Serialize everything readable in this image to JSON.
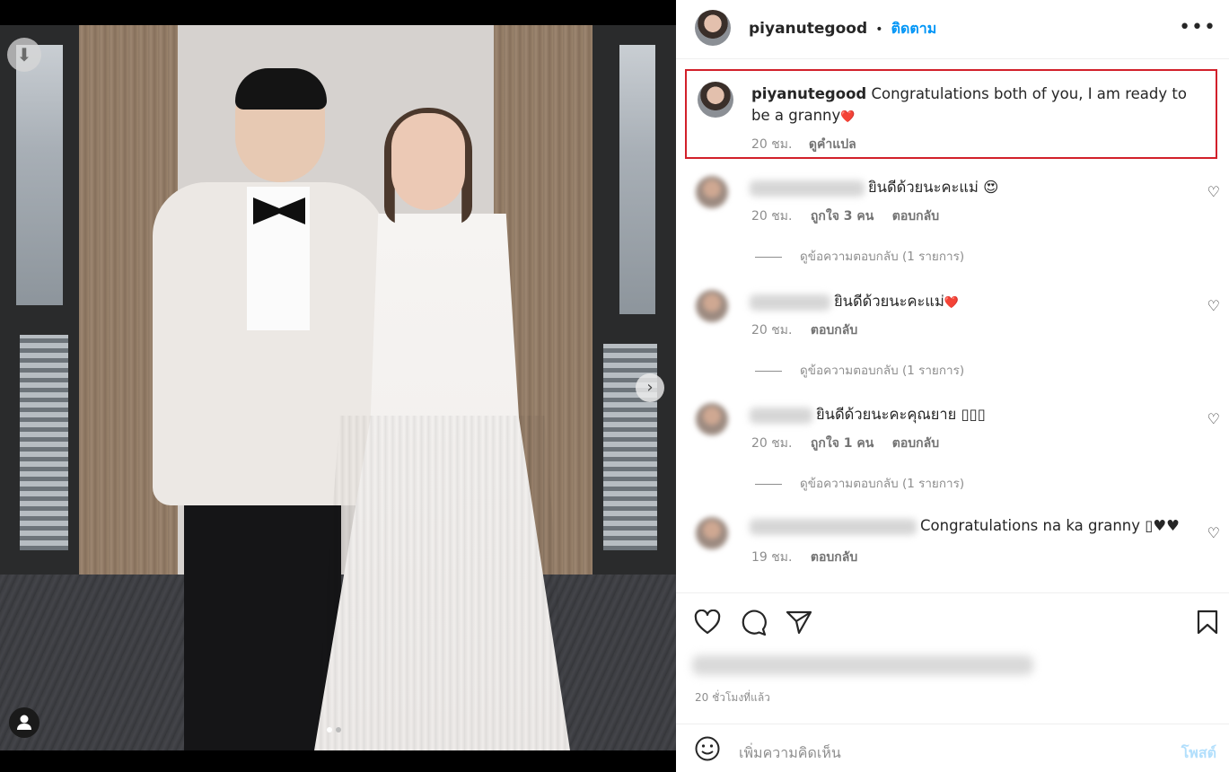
{
  "post": {
    "username": "piyanutegood",
    "separator": "•",
    "follow_label": "ติดตาม",
    "more_icon": "more-horizontal-icon",
    "caption": {
      "username": "piyanutegood",
      "text": "Congratulations both of you, I am ready to be a granny",
      "emoji": "❤️",
      "time": "20 ชม.",
      "translate_label": "ดูคำแปล"
    },
    "photo": {
      "slide_count": 2,
      "active_slide": 1
    }
  },
  "comments": [
    {
      "text": "ยินดีด้วยนะคะแม่",
      "emoji": "😍",
      "time": "20 ชม.",
      "likes": "ถูกใจ 3 คน",
      "reply_label": "ตอบกลับ",
      "replies_label": "ดูข้อความตอบกลับ (1 รายการ)"
    },
    {
      "text": "ยินดีด้วยนะคะแม่",
      "emoji": "❤️",
      "time": "20 ชม.",
      "likes": "",
      "reply_label": "ตอบกลับ",
      "replies_label": "ดูข้อความตอบกลับ (1 รายการ)"
    },
    {
      "text": "ยินดีด้วยนะคะคุณยาย",
      "emoji": "▯▯▯",
      "time": "20 ชม.",
      "likes": "ถูกใจ 1 คน",
      "reply_label": "ตอบกลับ",
      "replies_label": "ดูข้อความตอบกลับ (1 รายการ)"
    },
    {
      "text": "Congratulations na ka granny",
      "emoji": "▯♥♥",
      "time": "19 ชม.",
      "likes": "",
      "reply_label": "ตอบกลับ",
      "replies_label": ""
    }
  ],
  "footer": {
    "time_ago": "20 ชั่วโมงที่แล้ว",
    "add_comment_placeholder": "เพิ่มความคิดเห็น",
    "post_label": "โพสต์"
  },
  "colors": {
    "accent": "#0095f6",
    "highlight_border": "#d2202a",
    "text": "#262626",
    "muted": "#8e8e8e"
  }
}
